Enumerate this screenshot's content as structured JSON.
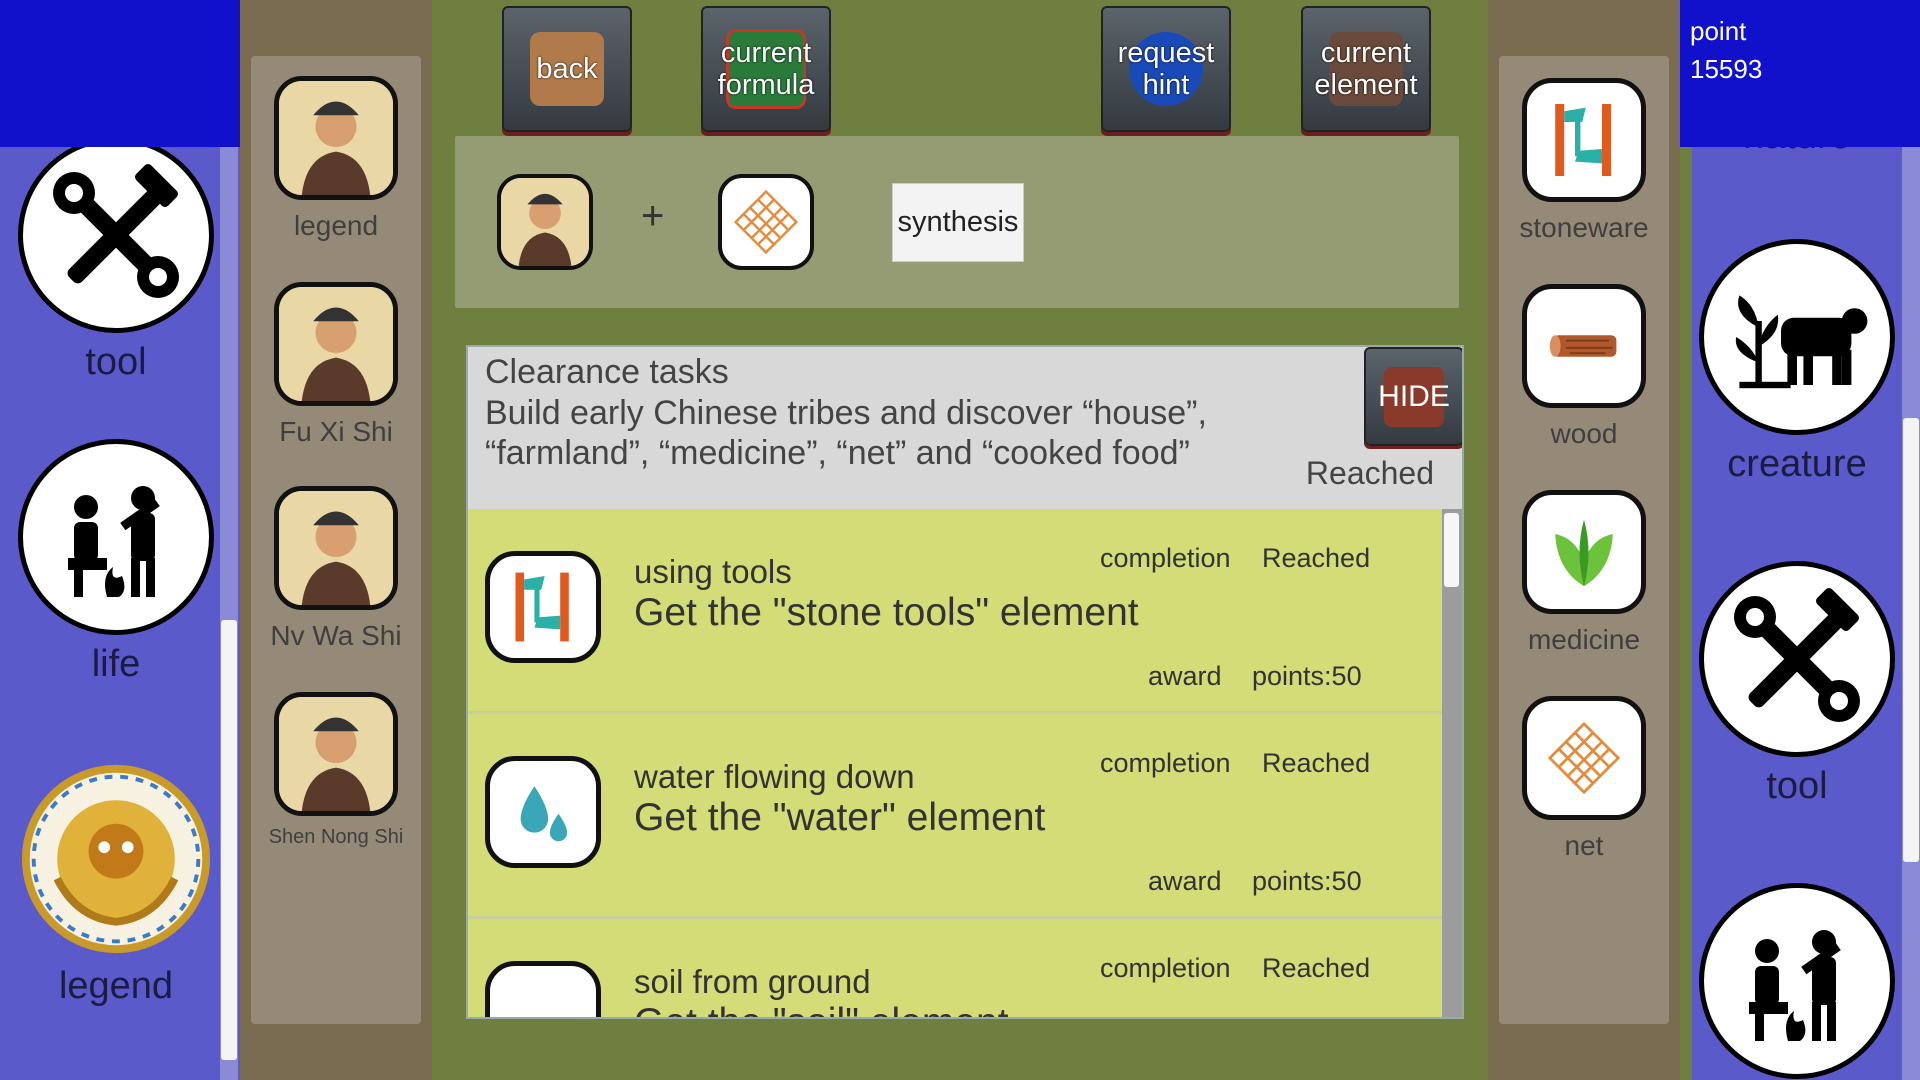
{
  "left_categories": [
    {
      "label": "tool",
      "icon": "tool-icon"
    },
    {
      "label": "life",
      "icon": "life-icon"
    },
    {
      "label": "legend",
      "icon": "dragon-icon"
    }
  ],
  "characters": [
    {
      "label": "legend",
      "icon": "emperor-portrait-icon"
    },
    {
      "label": "Fu Xi Shi",
      "icon": "fu-xi-portrait-icon"
    },
    {
      "label": "Nv Wa Shi",
      "icon": "nv-wa-portrait-icon"
    },
    {
      "label": "Shen Nong Shi",
      "icon": "shen-nong-portrait-icon"
    }
  ],
  "toolbar": {
    "back": "back",
    "current_formula": "current formula",
    "request_hint": "request hint",
    "current_element": "current element"
  },
  "formula": {
    "plus": "+",
    "synthesis": "synthesis",
    "slot1_icon": "emperor-portrait-icon",
    "slot2_icon": "net-icon"
  },
  "clearance": {
    "title": "Clearance tasks",
    "description": "Build early Chinese tribes and discover “house”, “farmland”, “medicine”, “net” and “cooked food”",
    "status": "Reached",
    "hide": "HIDE"
  },
  "tasks": [
    {
      "name": "using tools",
      "desc": "Get the \"stone tools\" element",
      "completion_label": "completion",
      "completion": "Reached",
      "award_label": "award",
      "points": "points:50",
      "icon": "stoneware-icon"
    },
    {
      "name": "water flowing down",
      "desc": "Get the \"water\" element",
      "completion_label": "completion",
      "completion": "Reached",
      "award_label": "award",
      "points": "points:50",
      "icon": "water-icon"
    },
    {
      "name": "soil from ground",
      "desc": "Get the \"soil\" element",
      "completion_label": "completion",
      "completion": "Reached",
      "award_label": "",
      "points": "",
      "icon": "soil-icon"
    }
  ],
  "elements": [
    {
      "label": "stoneware",
      "icon": "stoneware-icon"
    },
    {
      "label": "wood",
      "icon": "wood-icon"
    },
    {
      "label": "medicine",
      "icon": "medicine-icon"
    },
    {
      "label": "net",
      "icon": "net-icon"
    }
  ],
  "points": {
    "label": "point",
    "value": "15593"
  },
  "right_categories": [
    {
      "label": "nature",
      "icon": "nature-icon"
    },
    {
      "label": "creature",
      "icon": "creature-icon"
    },
    {
      "label": "tool",
      "icon": "tool-icon"
    },
    {
      "label": "life",
      "icon": "life-icon"
    }
  ],
  "colors": {
    "accent_blue": "#1111cc",
    "panel_blue": "#5a5acb",
    "task_yellow": "#d4dc78",
    "bg_olive": "#6f7f40"
  }
}
